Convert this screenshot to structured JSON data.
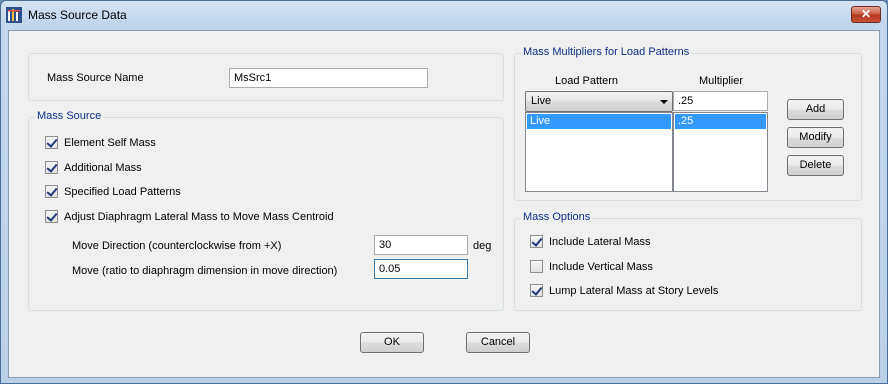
{
  "window": {
    "title": "Mass Source Data",
    "close_label": "✕"
  },
  "name_row": {
    "label": "Mass Source Name",
    "value": "MsSrc1"
  },
  "mass_source": {
    "title": "Mass Source",
    "element_self_mass": {
      "label": "Element Self Mass",
      "checked": true
    },
    "additional_mass": {
      "label": "Additional Mass",
      "checked": true
    },
    "specified_load_patterns": {
      "label": "Specified Load Patterns",
      "checked": true
    },
    "adjust_diaphragm": {
      "label": "Adjust Diaphragm Lateral Mass to Move Mass Centroid",
      "checked": true
    },
    "move_direction": {
      "label": "Move Direction (counterclockwise from +X)",
      "value": "30",
      "unit": "deg"
    },
    "move_ratio": {
      "label": "Move (ratio to diaphragm dimension in move direction)",
      "value": "0.05"
    }
  },
  "multipliers": {
    "title": "Mass Multipliers for Load Patterns",
    "col_load_pattern": "Load Pattern",
    "col_multiplier": "Multiplier",
    "selected_pattern": "Live",
    "multiplier_value": ".25",
    "rows": [
      {
        "pattern": "Live",
        "multiplier": ".25"
      }
    ],
    "add_label": "Add",
    "modify_label": "Modify",
    "delete_label": "Delete"
  },
  "mass_options": {
    "title": "Mass Options",
    "include_lateral": {
      "label": "Include Lateral Mass",
      "checked": true
    },
    "include_vertical": {
      "label": "Include Vertical Mass",
      "checked": false
    },
    "lump_lateral": {
      "label": "Lump Lateral Mass at Story Levels",
      "checked": true
    }
  },
  "footer": {
    "ok_label": "OK",
    "cancel_label": "Cancel"
  }
}
